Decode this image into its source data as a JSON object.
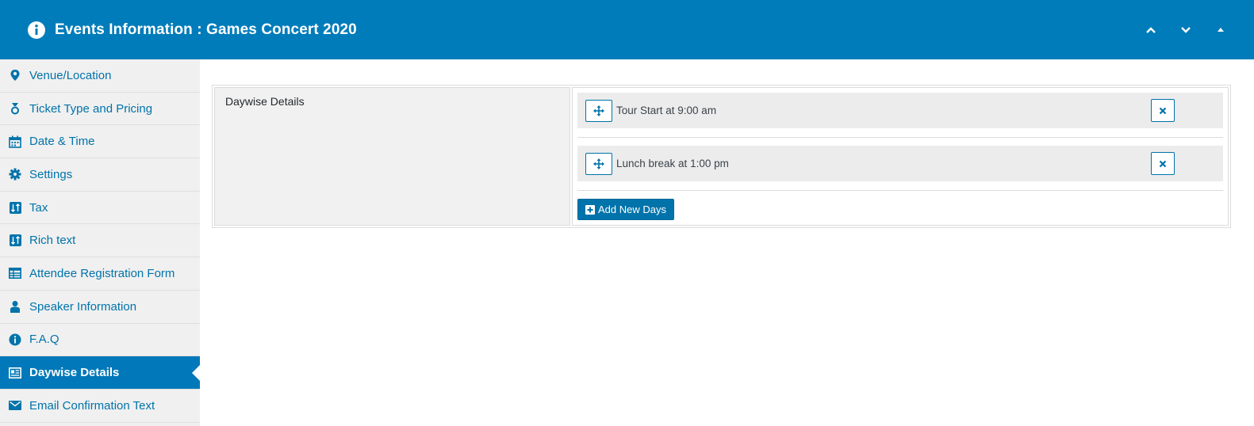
{
  "header": {
    "title": "Events Information : Games Concert 2020",
    "icon": "info-circle-icon",
    "controls": [
      "chevron-up-icon",
      "chevron-down-icon",
      "triangle-up-icon"
    ]
  },
  "sidebar": {
    "items": [
      {
        "label": "Venue/Location",
        "icon": "map-pin-icon"
      },
      {
        "label": "Ticket Type and Pricing",
        "icon": "ticket-icon"
      },
      {
        "label": "Date & Time",
        "icon": "calendar-icon"
      },
      {
        "label": "Settings",
        "icon": "gear-icon"
      },
      {
        "label": "Tax",
        "icon": "sort-icon"
      },
      {
        "label": "Rich text",
        "icon": "sort-icon"
      },
      {
        "label": "Attendee Registration Form",
        "icon": "table-icon"
      },
      {
        "label": "Speaker Information",
        "icon": "user-icon"
      },
      {
        "label": "F.A.Q",
        "icon": "info-circle-icon"
      },
      {
        "label": "Daywise Details",
        "icon": "newspaper-icon",
        "active": true
      },
      {
        "label": "Email Confirmation Text",
        "icon": "envelope-icon"
      }
    ]
  },
  "main": {
    "section_label": "Daywise Details",
    "days": [
      {
        "text": "Tour Start at 9:00 am"
      },
      {
        "text": "Lunch break at 1:00 pm"
      }
    ],
    "add_button_label": "Add New Days"
  },
  "colors": {
    "primary": "#007cba",
    "link": "#0073aa",
    "sidebar_bg": "#f0f0f0"
  }
}
